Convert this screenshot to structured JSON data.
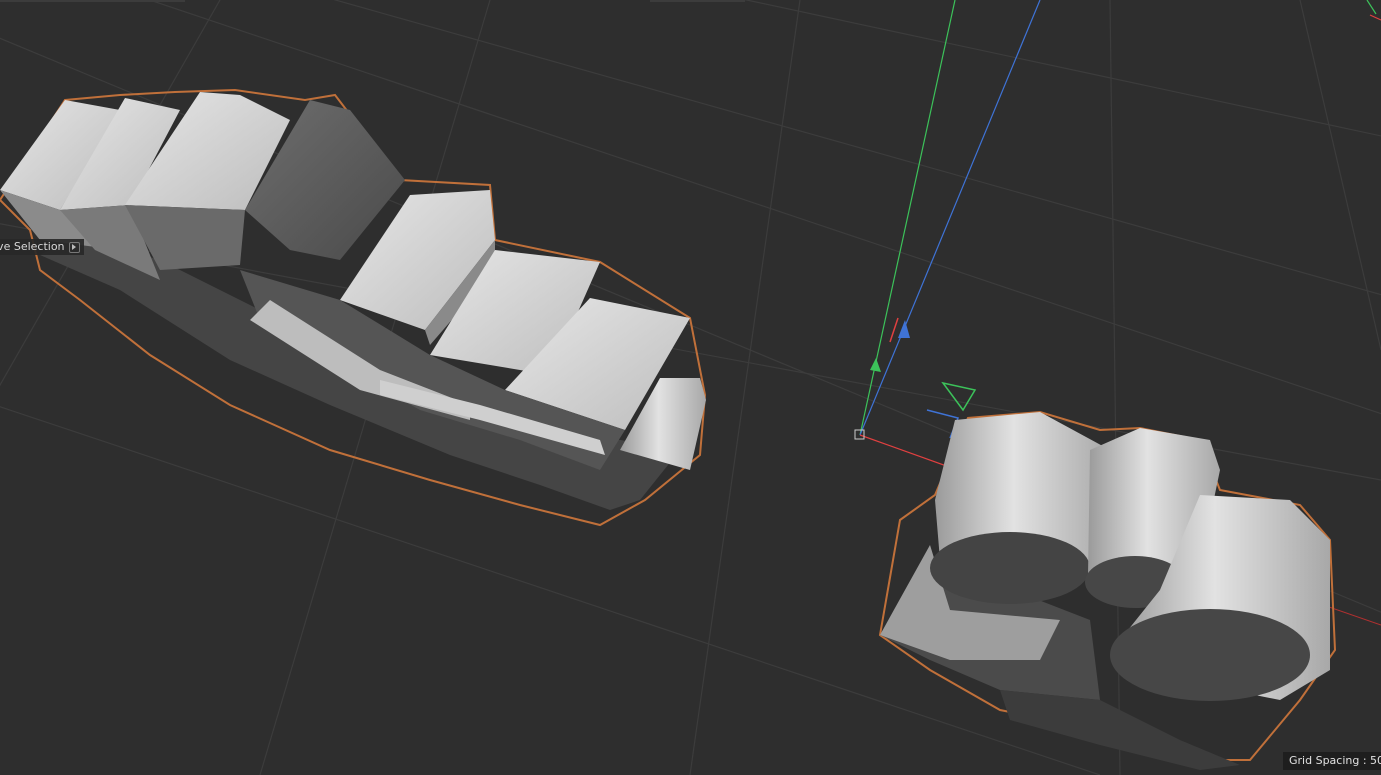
{
  "viewport": {
    "hud_label": "ive Selection",
    "grid_spacing_label": "Grid Spacing : 50 c",
    "colors": {
      "background": "#2e2e2e",
      "grid_line": "#3b3b3b",
      "object_fill": "#c9c9c9",
      "object_shadow": "#4a4a4a",
      "selection_outline": "#c0703a",
      "axis_x": "#e04040",
      "axis_y": "#3cc25a",
      "axis_z": "#3f73d6"
    },
    "icons": [
      "hud-play-icon",
      "axis-gizmo",
      "object-axis-handle"
    ]
  }
}
